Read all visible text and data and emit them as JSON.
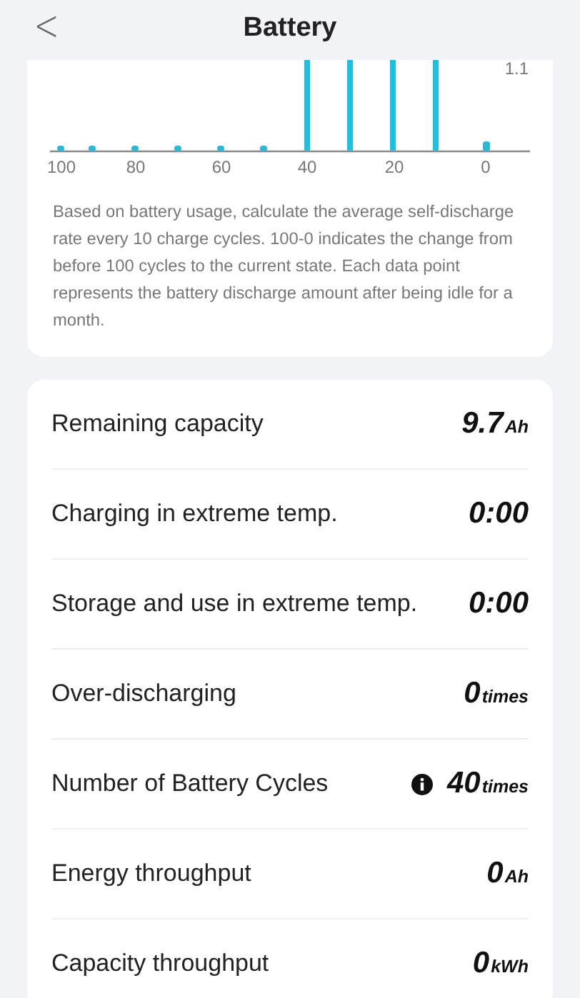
{
  "header": {
    "title": "Battery",
    "back": "<"
  },
  "chart": {
    "x_labels": [
      "100",
      "80",
      "60",
      "40",
      "20",
      "0"
    ],
    "y_label": "1.1"
  },
  "description": "Based on battery usage, calculate the average self-discharge rate every 10 charge cycles. 100-0 indicates the change from before 100 cycles to the current state. Each data point represents the battery discharge amount after being idle for a month.",
  "stats": [
    {
      "label": "Remaining capacity",
      "value": "9.7",
      "unit": "Ah",
      "has_info": false
    },
    {
      "label": "Charging in extreme temp.",
      "value": "0:00",
      "has_info": false
    },
    {
      "label": "Storage and use in extreme temp.",
      "value": "0:00",
      "has_info": false
    },
    {
      "label": "Over-discharging",
      "value": "0",
      "unit": "times",
      "has_info": false
    },
    {
      "label": "Number of Battery Cycles",
      "value": "40",
      "unit": "times",
      "has_info": true
    },
    {
      "label": "Energy throughput",
      "value": "0",
      "unit": "Ah",
      "has_info": false
    },
    {
      "label": "Capacity throughput",
      "value": "0",
      "unit": "kWh",
      "has_info": false
    }
  ]
}
